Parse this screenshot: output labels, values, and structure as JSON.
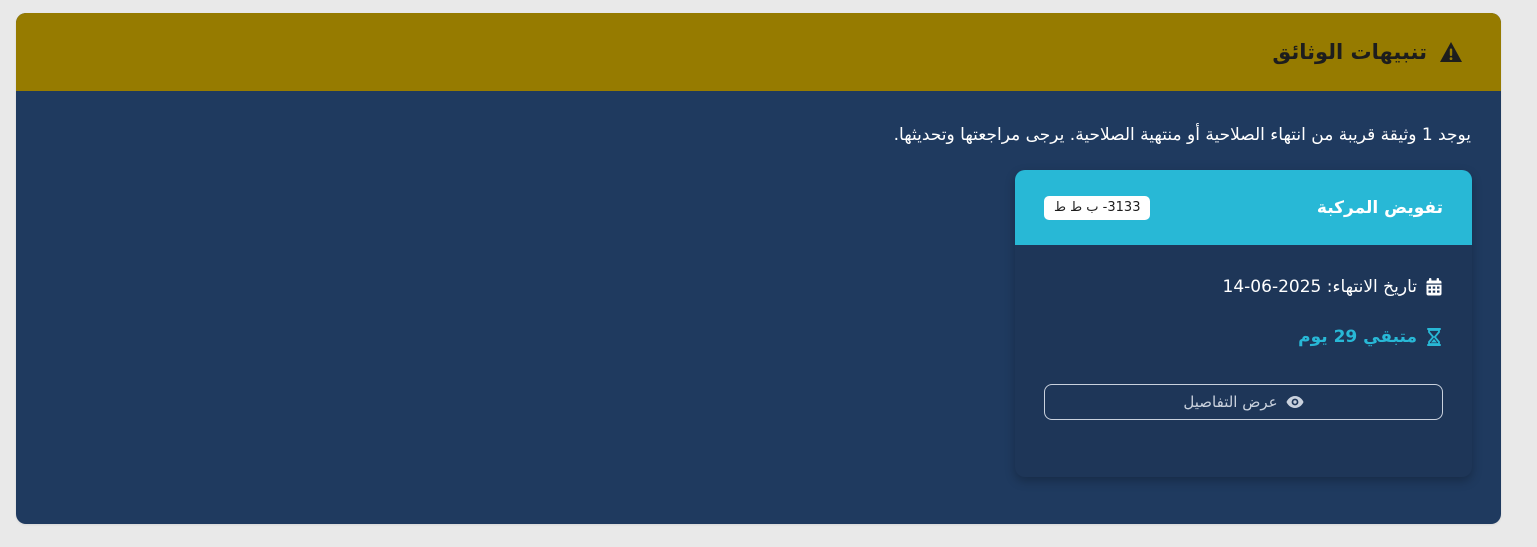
{
  "alert": {
    "title": "تنبيهات الوثائق",
    "message": "يوجد 1 وثيقة قريبة من انتهاء الصلاحية أو منتهية الصلاحية. يرجى مراجعتها وتحديثها.",
    "icon": "warning-triangle-icon"
  },
  "document": {
    "title": "تفويض المركبة",
    "plate": "3133- ب ط ط",
    "expiry_text": "تاريخ الانتهاء: 2025-06-14",
    "remaining_text": "متبقي 29 يوم",
    "details_label": "عرض التفاصيل",
    "icons": {
      "expiry": "calendar-icon",
      "remaining": "hourglass-icon",
      "details": "eye-icon"
    }
  },
  "colors": {
    "page_background": "#e9e9e9",
    "header_background": "#967b00",
    "body_background": "#1f3a5f",
    "card_header": "#28b8d6",
    "accent": "#28b8d6"
  }
}
